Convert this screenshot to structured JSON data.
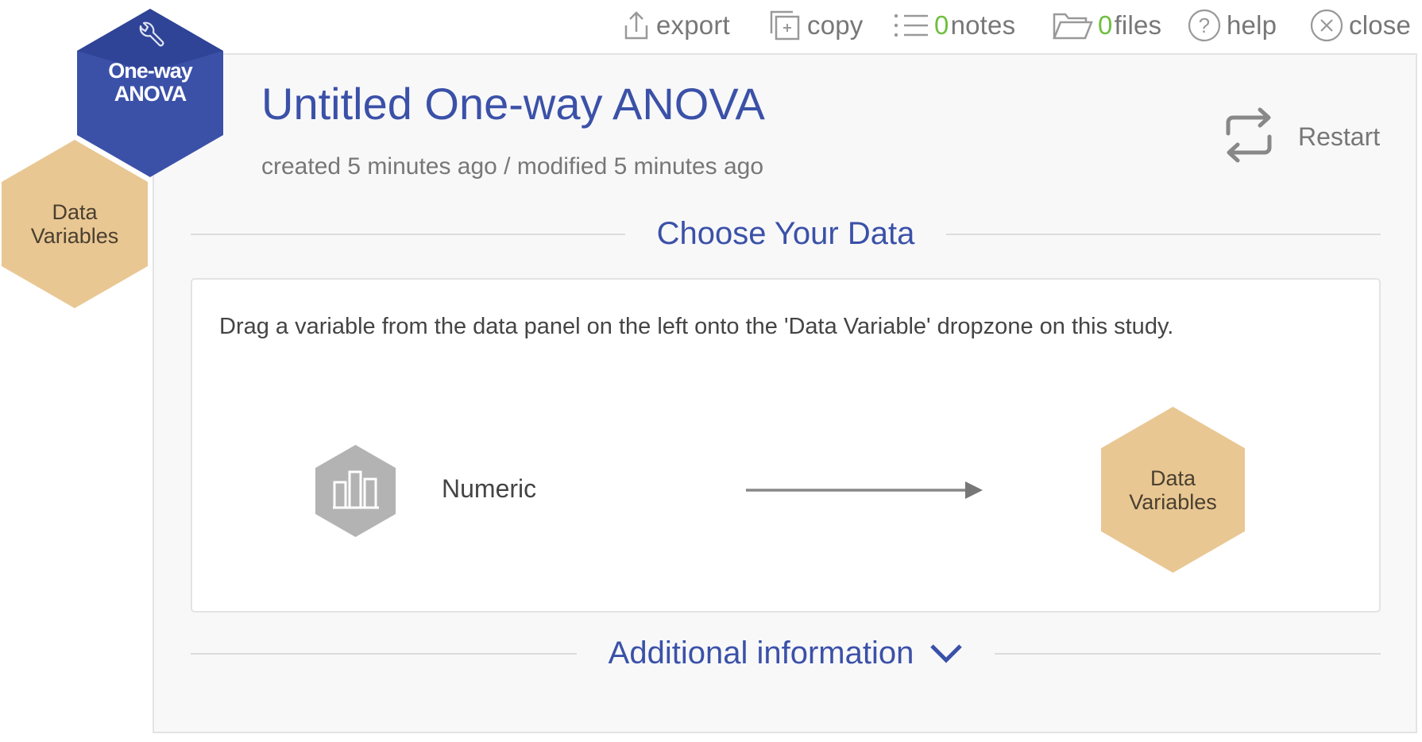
{
  "toolbar": {
    "export_label": "export",
    "copy_label": "copy",
    "notes_count": "0",
    "notes_label": "notes",
    "files_count": "0",
    "files_label": "files",
    "help_label": "help",
    "close_label": "close"
  },
  "sidebar": {
    "analysis_hex": {
      "line1": "One-way",
      "line2": "ANOVA",
      "icon": "wrench-icon"
    },
    "data_hex": {
      "line1": "Data",
      "line2": "Variables"
    }
  },
  "header": {
    "title": "Untitled One-way ANOVA",
    "subtitle": "created 5 minutes ago / modified 5 minutes ago",
    "restart_label": "Restart"
  },
  "main": {
    "section_title": "Choose Your Data",
    "instruction": "Drag a variable from the data panel on the left onto the 'Data Variable' dropzone on this study.",
    "source_variable": {
      "type_label": "Numeric",
      "icon": "bar-chart-icon"
    },
    "dropzone": {
      "line1": "Data",
      "line2": "Variables"
    },
    "additional_info_label": "Additional information"
  },
  "colors": {
    "accent": "#3b51a8",
    "dropzone": "#e9c793",
    "count_green": "#6fbf3f",
    "muted_text": "#777777"
  }
}
